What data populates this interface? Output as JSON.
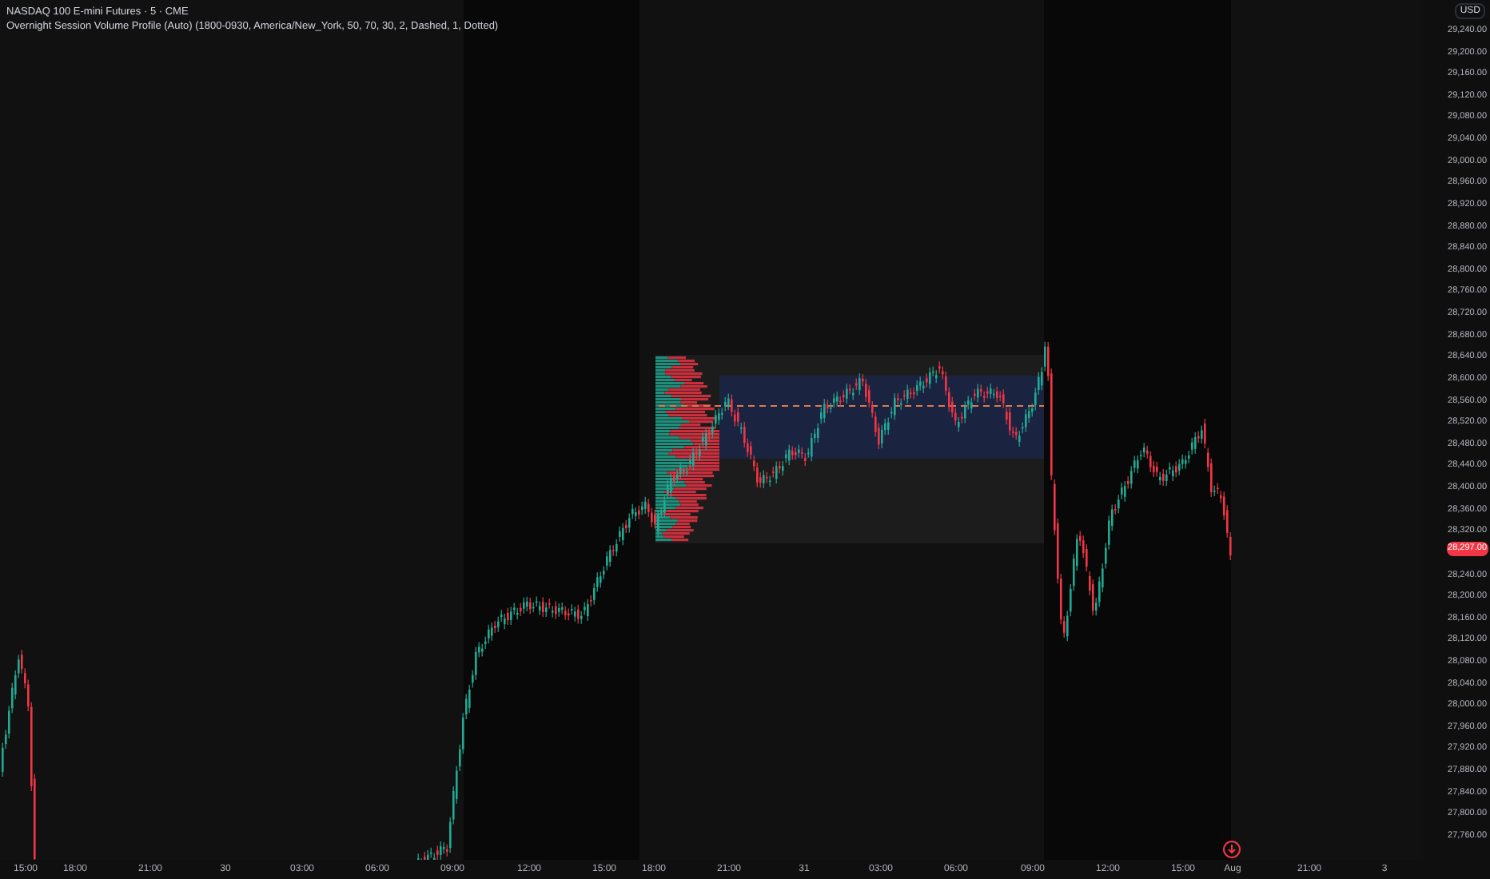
{
  "chart": {
    "title": "NASDAQ 100 E-mini Futures · 5 · CME",
    "indicator": "Overnight Session Volume Profile (Auto) (1800-0930, America/New_York, 50, 70, 30, 2, Dashed, 1, Dotted)"
  },
  "price_axis": {
    "currency": "USD",
    "labels": [
      "29,240.00",
      "29,200.00",
      "29,160.00",
      "29,120.00",
      "29,080.00",
      "29,040.00",
      "29,000.00",
      "28,960.00",
      "28,920.00",
      "28,880.00",
      "28,840.00",
      "28,800.00",
      "28,760.00",
      "28,720.00",
      "28,680.00",
      "28,640.00",
      "28,600.00",
      "28,560.00",
      "28,520.00",
      "28,480.00",
      "28,440.00",
      "28,400.00",
      "28,360.00",
      "28,320.00",
      "28,240.00",
      "28,200.00",
      "28,160.00",
      "28,120.00",
      "28,080.00",
      "28,040.00",
      "28,000.00",
      "27,960.00",
      "27,920.00",
      "27,880.00",
      "27,840.00",
      "27,800.00",
      "27,760.00"
    ],
    "current_price": "28,297.00"
  },
  "time_axis": {
    "labels": [
      "15:00",
      "18:00",
      "21:00",
      "30",
      "03:00",
      "06:00",
      "09:00",
      "12:00",
      "15:00",
      "18:00",
      "21:00",
      "31",
      "03:00",
      "06:00",
      "09:00",
      "12:00",
      "15:00",
      "Aug",
      "21:00",
      "3"
    ]
  }
}
